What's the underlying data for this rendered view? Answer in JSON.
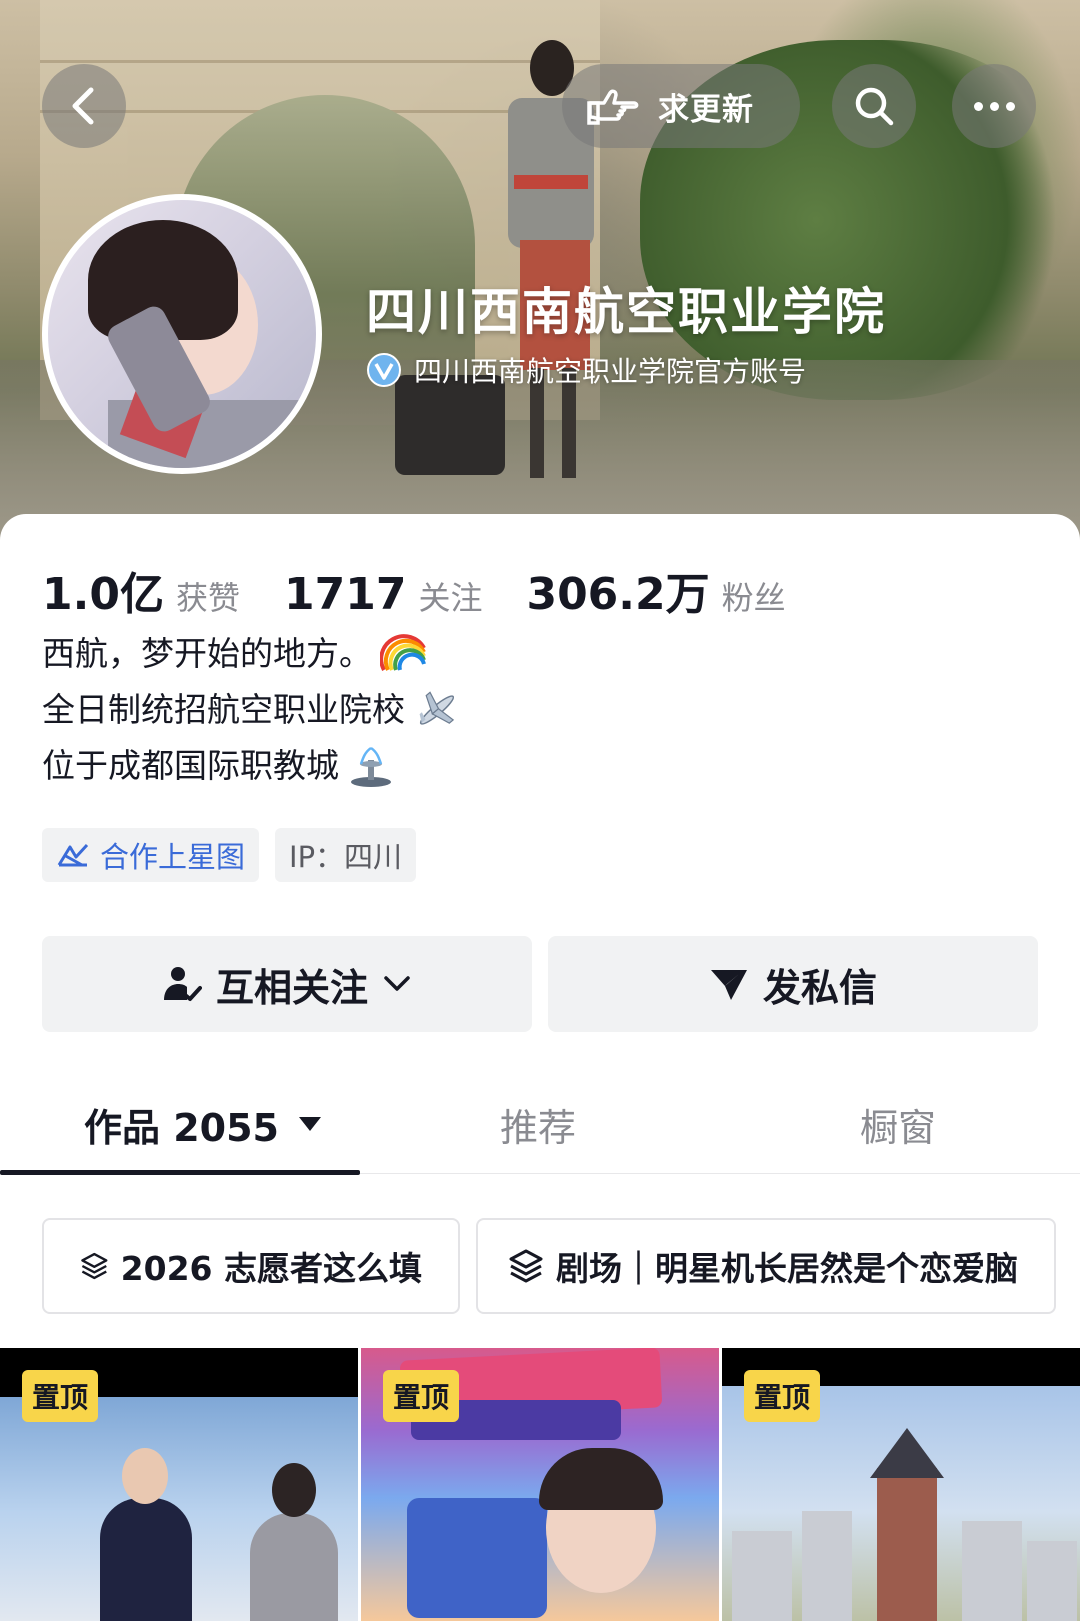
{
  "header": {
    "update_label": "求更新",
    "profile_name": "四川西南航空职业学院",
    "verified_label": "四川西南航空职业学院官方账号"
  },
  "stats": [
    {
      "value": "1.0亿",
      "label": "获赞"
    },
    {
      "value": "1717",
      "label": "关注"
    },
    {
      "value": "306.2万",
      "label": "粉丝"
    }
  ],
  "bio": {
    "line1": "西航，梦开始的地方。",
    "line1_emoji": "rainbow-emoji",
    "line2": "全日制统招航空职业院校",
    "line2_emoji": "airplane-emoji",
    "line3": "位于成都国际职教城",
    "line3_emoji": "fountain-emoji"
  },
  "tags": {
    "cooperate": "合作上星图",
    "ip": "IP：四川"
  },
  "actions": {
    "follow_label": "互相关注",
    "message_label": "发私信"
  },
  "tabs": {
    "works": "作品 2055",
    "recommend": "推荐",
    "shop": "橱窗"
  },
  "collections": [
    {
      "label": "2026 志愿者这么填"
    },
    {
      "label": "剧场｜明星机长居然是个恋爱脑"
    }
  ],
  "videos": [
    {
      "pin_label": "置顶"
    },
    {
      "pin_label": "置顶"
    },
    {
      "pin_label": "置顶"
    }
  ],
  "colors": {
    "accent_blue": "#3a6bd8",
    "pin_yellow": "#f8d54a",
    "text_primary": "#161823",
    "text_secondary": "#8a8b91"
  }
}
